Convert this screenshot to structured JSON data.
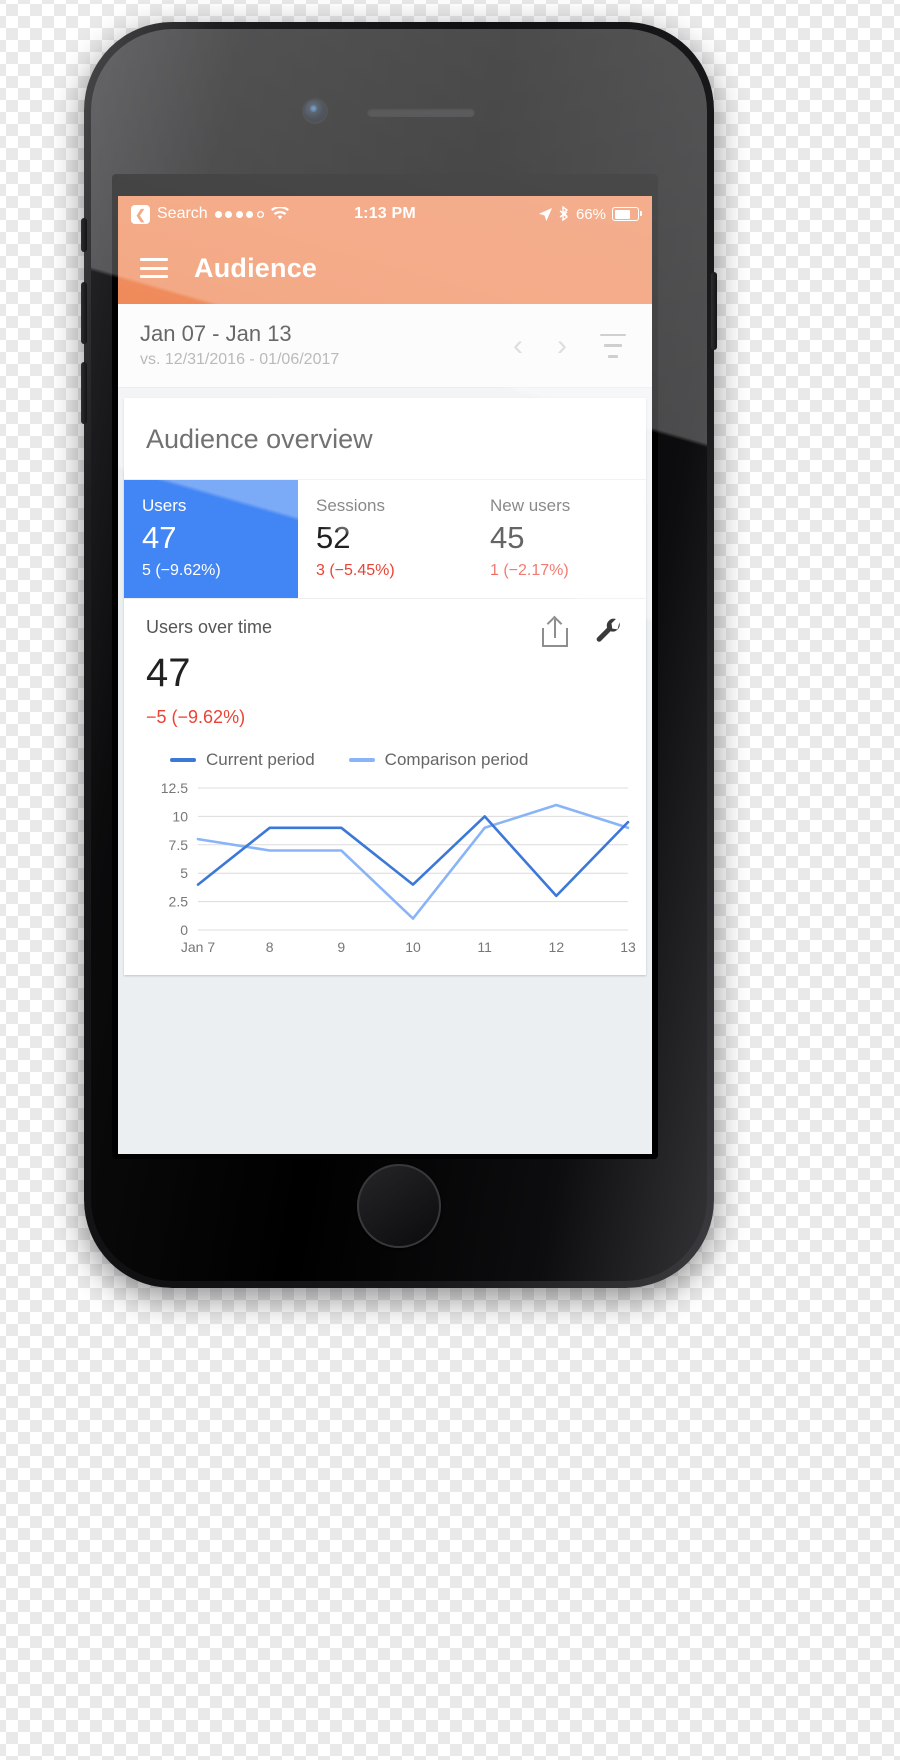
{
  "status_bar": {
    "back_icon": "back-chevron-icon",
    "back_label": "Search",
    "signal_dots_filled": 4,
    "signal_dots_total": 5,
    "wifi_icon": "wifi-icon",
    "time": "1:13 PM",
    "location_icon": "location-arrow-icon",
    "bluetooth_icon": "bluetooth-icon",
    "battery_percent": "66%",
    "battery_level": 66
  },
  "app_bar": {
    "menu_icon": "hamburger-menu-icon",
    "title": "Audience",
    "background": "#E8550F"
  },
  "date_bar": {
    "range": "Jan 07 - Jan 13",
    "comparison": "vs. 12/31/2016 - 01/06/2017",
    "prev_icon": "chevron-left-icon",
    "next_icon": "chevron-right-icon",
    "filter_icon": "filter-icon"
  },
  "overview": {
    "title": "Audience overview",
    "metrics": [
      {
        "label": "Users",
        "value": "47",
        "delta": "5 (−9.62%)",
        "selected": true
      },
      {
        "label": "Sessions",
        "value": "52",
        "delta": "3 (−5.45%)",
        "selected": false
      },
      {
        "label": "New users",
        "value": "45",
        "delta": "1 (−2.17%)",
        "selected": false
      }
    ]
  },
  "chart_card": {
    "title": "Users over time",
    "value": "47",
    "delta": "−5 (−9.62%)",
    "share_icon": "share-icon",
    "settings_icon": "wrench-icon"
  },
  "colors": {
    "brand_orange": "#E8550F",
    "selected_blue": "#4285F4",
    "negative_red": "#EA4335",
    "current_period": "#3C78D8",
    "comparison_period": "#8AB4F8"
  },
  "chart_data": {
    "type": "line",
    "title": "Users over time",
    "xlabel": "",
    "ylabel": "",
    "x": [
      "Jan 7",
      "8",
      "9",
      "10",
      "11",
      "12",
      "13"
    ],
    "ytick_labels": [
      "0",
      "2.5",
      "5",
      "7.5",
      "10",
      "12.5"
    ],
    "ylim": [
      0,
      12.5
    ],
    "grid": true,
    "legend_position": "top-left",
    "series": [
      {
        "name": "Current period",
        "color": "#3C78D8",
        "values": [
          4,
          9,
          9,
          4,
          10,
          3,
          9.5
        ]
      },
      {
        "name": "Comparison period",
        "color": "#8AB4F8",
        "values": [
          8,
          7,
          7,
          1,
          9,
          11,
          9
        ]
      }
    ]
  }
}
